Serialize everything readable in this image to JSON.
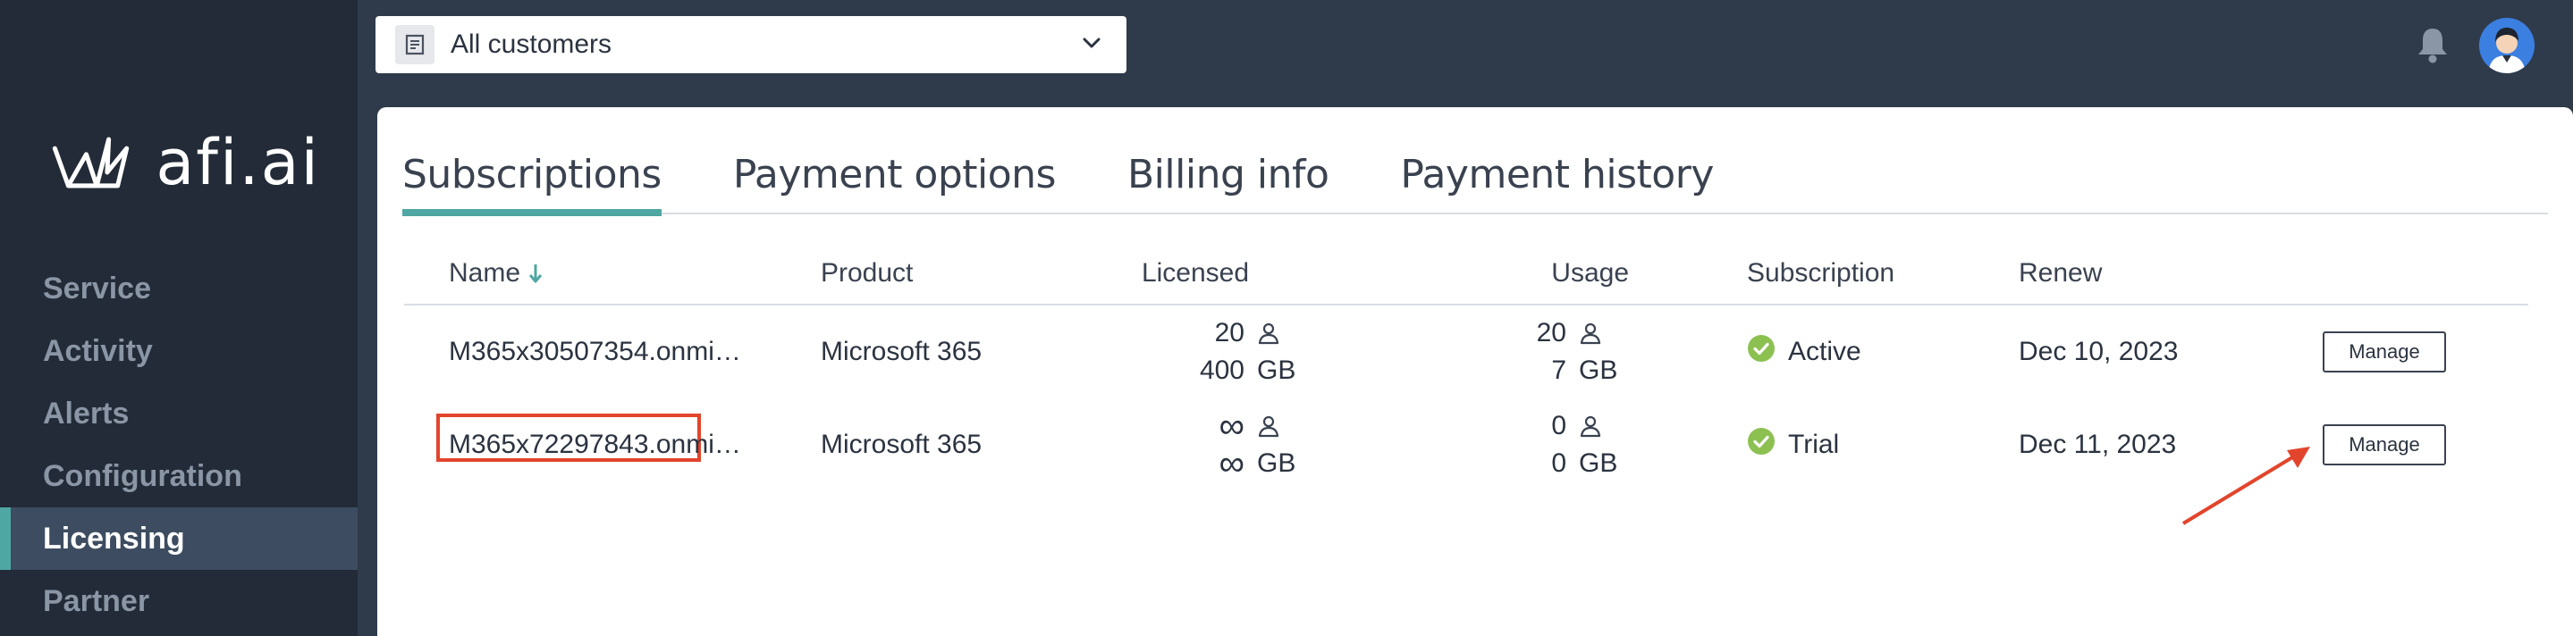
{
  "brand": {
    "logo_text": "afi.ai"
  },
  "sidebar": {
    "items": [
      {
        "label": "Service",
        "active": false
      },
      {
        "label": "Activity",
        "active": false
      },
      {
        "label": "Alerts",
        "active": false
      },
      {
        "label": "Configuration",
        "active": false
      },
      {
        "label": "Licensing",
        "active": true
      },
      {
        "label": "Partner",
        "active": false
      }
    ]
  },
  "topbar": {
    "customer_select": {
      "value": "All customers",
      "icon": "document-icon"
    },
    "notifications_icon": "bell-icon",
    "avatar_icon": "user-avatar"
  },
  "tabs": [
    {
      "label": "Subscriptions",
      "active": true
    },
    {
      "label": "Payment options",
      "active": false
    },
    {
      "label": "Billing info",
      "active": false
    },
    {
      "label": "Payment history",
      "active": false
    }
  ],
  "table": {
    "headers": {
      "name": "Name",
      "product": "Product",
      "licensed": "Licensed",
      "usage": "Usage",
      "subscription": "Subscription",
      "renew": "Renew"
    },
    "sort": {
      "column": "name",
      "direction": "ascending"
    },
    "rows": [
      {
        "name": "M365x30507354.onmi…",
        "product": "Microsoft 365",
        "licensed_users": "20",
        "licensed_storage": "400",
        "usage_users": "20",
        "usage_storage": "7",
        "storage_unit": "GB",
        "status": "Active",
        "renew": "Dec 10, 2023",
        "action": "Manage",
        "highlighted": false
      },
      {
        "name": "M365x72297843.onmi…",
        "product": "Microsoft 365",
        "licensed_users": "∞",
        "licensed_storage": "∞",
        "usage_users": "0",
        "usage_storage": "0",
        "storage_unit": "GB",
        "status": "Trial",
        "renew": "Dec 11, 2023",
        "action": "Manage",
        "highlighted": true
      }
    ]
  },
  "colors": {
    "accent": "#4fa7a3",
    "status_ok": "#8cc152",
    "highlight": "#e2452c"
  }
}
